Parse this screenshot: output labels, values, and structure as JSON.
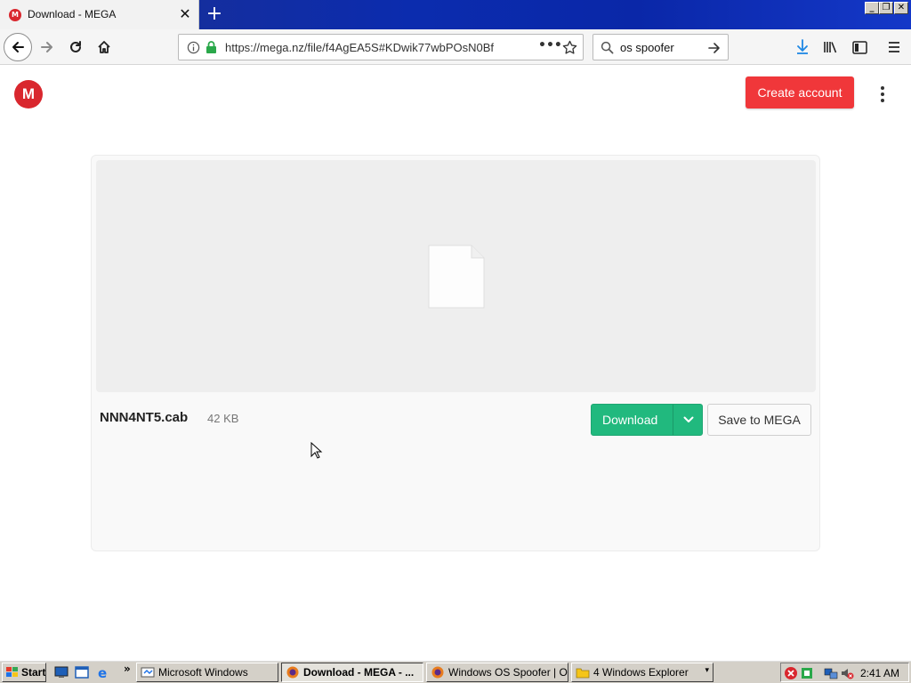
{
  "browser": {
    "tab_title": "Download - MEGA",
    "tab_favicon_letter": "M",
    "url": "https://mega.nz/file/f4AgEA5S#KDwik77wbPOsN0Bf",
    "search_text": "os spoofer",
    "colors": {
      "tabbar": "#0b2cae",
      "download_arrow": "#1e88e5"
    }
  },
  "header": {
    "logo_letter": "M",
    "create_account_label": "Create account",
    "colors": {
      "brand": "#d9272e",
      "create_account": "#f0373a"
    }
  },
  "file": {
    "name": "NNN4NT5.cab",
    "size": "42 KB",
    "download_label": "Download",
    "save_label": "Save to MEGA",
    "colors": {
      "download": "#21b97e"
    }
  },
  "taskbar": {
    "start_label": "Start",
    "items": [
      {
        "label": "Microsoft Windows"
      },
      {
        "label": "Download - MEGA - ..."
      },
      {
        "label": "Windows OS Spoofer | O..."
      },
      {
        "label": "4 Windows Explorer"
      }
    ],
    "overflow_label": "»",
    "clock": "2:41 AM"
  }
}
